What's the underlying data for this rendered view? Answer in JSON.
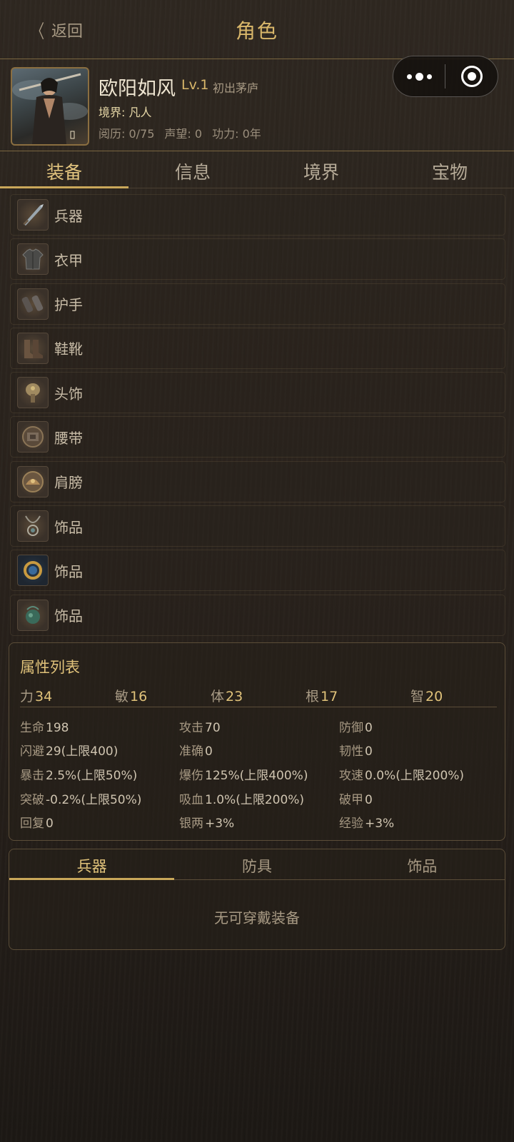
{
  "nav": {
    "back_label": "返回",
    "title": "角色"
  },
  "capsule": {
    "more": "more-icon",
    "close": "close-target-icon"
  },
  "hero": {
    "name": "欧阳如风",
    "level": "Lv.1",
    "stage": "初出茅庐",
    "realm": "境界: 凡人",
    "stats": [
      "阅历: 0/75",
      "声望: 0",
      "功力: 0年"
    ]
  },
  "tabs": [
    "装备",
    "信息",
    "境界",
    "宝物"
  ],
  "slots": [
    {
      "label": "兵器",
      "icon": "sword-icon"
    },
    {
      "label": "衣甲",
      "icon": "armor-icon"
    },
    {
      "label": "护手",
      "icon": "gauntlet-icon"
    },
    {
      "label": "鞋靴",
      "icon": "boots-icon"
    },
    {
      "label": "头饰",
      "icon": "headwear-icon"
    },
    {
      "label": "腰带",
      "icon": "belt-icon"
    },
    {
      "label": "肩膀",
      "icon": "shoulder-icon"
    },
    {
      "label": "饰品",
      "icon": "necklace-icon"
    },
    {
      "label": "饰品",
      "icon": "ring-icon"
    },
    {
      "label": "饰品",
      "icon": "amulet-icon"
    }
  ],
  "attributes": {
    "title": "属性列表",
    "primary": [
      {
        "label": "力",
        "value": "34"
      },
      {
        "label": "敏",
        "value": "16"
      },
      {
        "label": "体",
        "value": "23"
      },
      {
        "label": "根",
        "value": "17"
      },
      {
        "label": "智",
        "value": "20"
      }
    ],
    "secondary": [
      {
        "label": "生命",
        "value": "198"
      },
      {
        "label": "攻击",
        "value": "70"
      },
      {
        "label": "防御",
        "value": "0"
      },
      {
        "label": "闪避",
        "value": "29(上限400)"
      },
      {
        "label": "准确",
        "value": "0"
      },
      {
        "label": "韧性",
        "value": "0"
      },
      {
        "label": "暴击",
        "value": "2.5%(上限50%)"
      },
      {
        "label": "爆伤",
        "value": "125%(上限400%)"
      },
      {
        "label": "攻速",
        "value": "0.0%(上限200%)"
      },
      {
        "label": "突破",
        "value": "-0.2%(上限50%)"
      },
      {
        "label": "吸血",
        "value": "1.0%(上限200%)"
      },
      {
        "label": "破甲",
        "value": "0"
      },
      {
        "label": "回复",
        "value": "0"
      },
      {
        "label": "银两",
        "value": "+3%"
      },
      {
        "label": "经验",
        "value": "+3%"
      }
    ]
  },
  "equip_tabs": [
    "兵器",
    "防具",
    "饰品"
  ],
  "equip_empty": "无可穿戴装备",
  "colors": {
    "accent": "#d9b76a",
    "text": "#d8cdb8",
    "muted": "#a89a84",
    "border": "#7a6640"
  }
}
